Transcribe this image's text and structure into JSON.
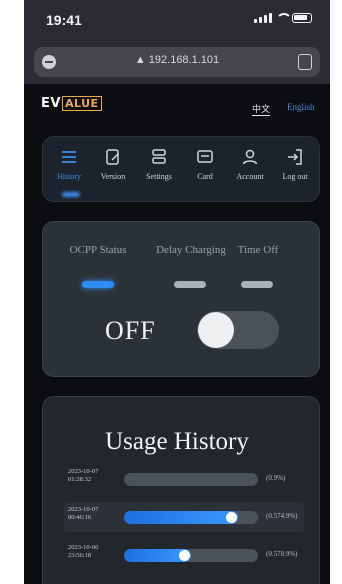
{
  "status_bar": {
    "time": "19:41"
  },
  "browser": {
    "url": "▲ 192.168.1.101"
  },
  "header": {
    "logo_ev": "EV",
    "logo_alue": "ALUE",
    "lang_zh": "中文",
    "lang_en": "English"
  },
  "nav": {
    "items": [
      {
        "label": "History",
        "icon": "history-icon",
        "active": true
      },
      {
        "label": "Version",
        "icon": "version-icon",
        "active": false
      },
      {
        "label": "Settings",
        "icon": "settings-icon",
        "active": false
      },
      {
        "label": "Card",
        "icon": "card-icon",
        "active": false
      },
      {
        "label": "Account",
        "icon": "account-icon",
        "active": false
      },
      {
        "label": "Log out",
        "icon": "logout-icon",
        "active": false
      }
    ]
  },
  "power": {
    "modes": [
      {
        "label": "OCPP Status",
        "selected": true
      },
      {
        "label": "Delay Charging",
        "selected": false
      },
      {
        "label": "Time Off",
        "selected": false
      }
    ],
    "state_label": "OFF",
    "toggle_on": false
  },
  "usage": {
    "title": "Usage History",
    "rows": [
      {
        "date": "2023-10-07",
        "time": "01:28:32",
        "value": "(0.9%)",
        "fraction": 0.0
      },
      {
        "date": "2023-10-07",
        "time": "00:46:16",
        "value": "(0.574.9%)",
        "fraction": 0.85
      },
      {
        "date": "2023-10-06",
        "time": "23:56:18",
        "value": "(0.578.9%)",
        "fraction": 0.5
      }
    ]
  },
  "colors": {
    "accent": "#2f8cf2",
    "background": "#0c0d10",
    "logo_accent": "#e9a94b"
  }
}
